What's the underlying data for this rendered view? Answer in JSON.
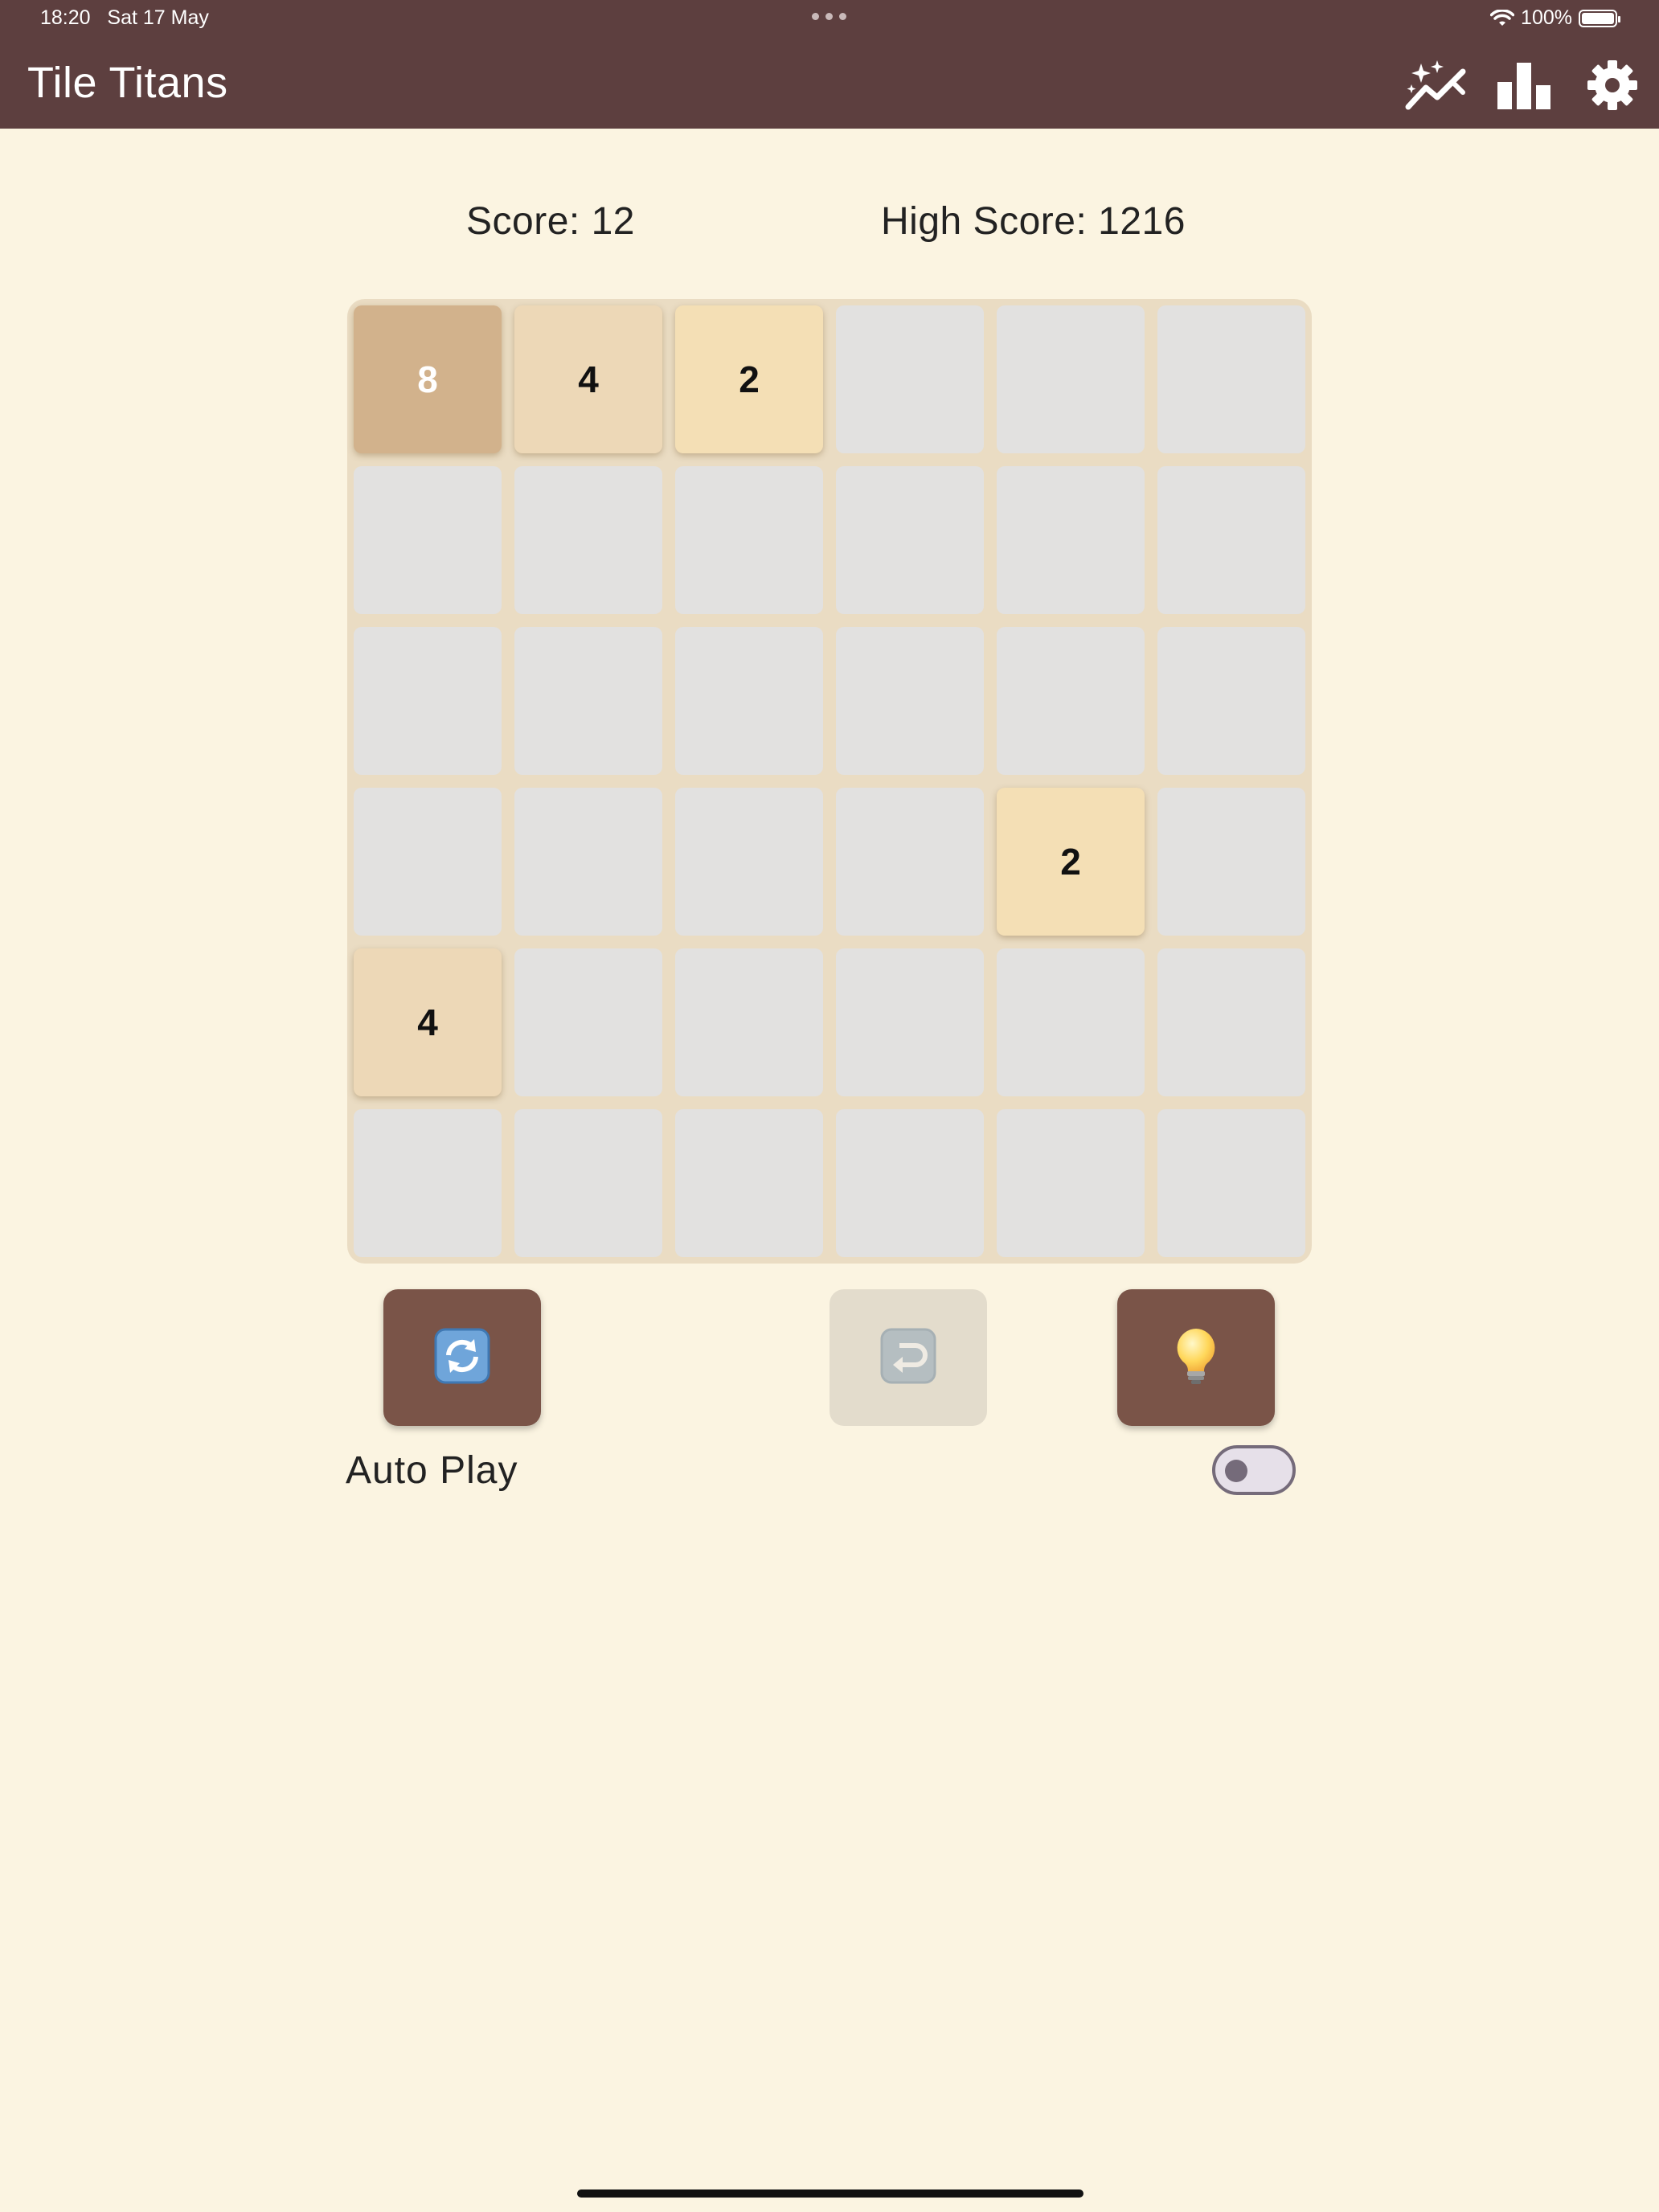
{
  "status_bar": {
    "time": "18:20",
    "date": "Sat 17 May",
    "battery": "100%"
  },
  "app_bar": {
    "title": "Tile Titans",
    "icons": [
      "sparkle-trend-icon",
      "bar-chart-icon",
      "gear-icon"
    ],
    "background": "#5D3F3F"
  },
  "scores": {
    "score_label": "Score: 12",
    "high_score_label": "High Score: 1216"
  },
  "board": {
    "rows": 6,
    "cols": 6,
    "cells": [
      [
        "8",
        "4",
        "2",
        "",
        "",
        ""
      ],
      [
        "",
        "",
        "",
        "",
        "",
        ""
      ],
      [
        "",
        "",
        "",
        "",
        "",
        ""
      ],
      [
        "",
        "",
        "",
        "",
        "2",
        ""
      ],
      [
        "4",
        "",
        "",
        "",
        "",
        ""
      ],
      [
        "",
        "",
        "",
        "",
        "",
        ""
      ]
    ],
    "tile_colors": {
      "2": "#F4DFB5",
      "4": "#EDD8B7",
      "8": "#D2B28C",
      "empty": "#E2E1E0"
    }
  },
  "actions": {
    "restart": {
      "icon": "restart-icon",
      "glyph": "🔄",
      "enabled": true
    },
    "undo": {
      "icon": "undo-icon",
      "glyph": "↩",
      "enabled": false
    },
    "hint": {
      "icon": "lightbulb-icon",
      "glyph": "💡",
      "enabled": true
    }
  },
  "autoplay": {
    "label": "Auto Play",
    "on": false
  }
}
